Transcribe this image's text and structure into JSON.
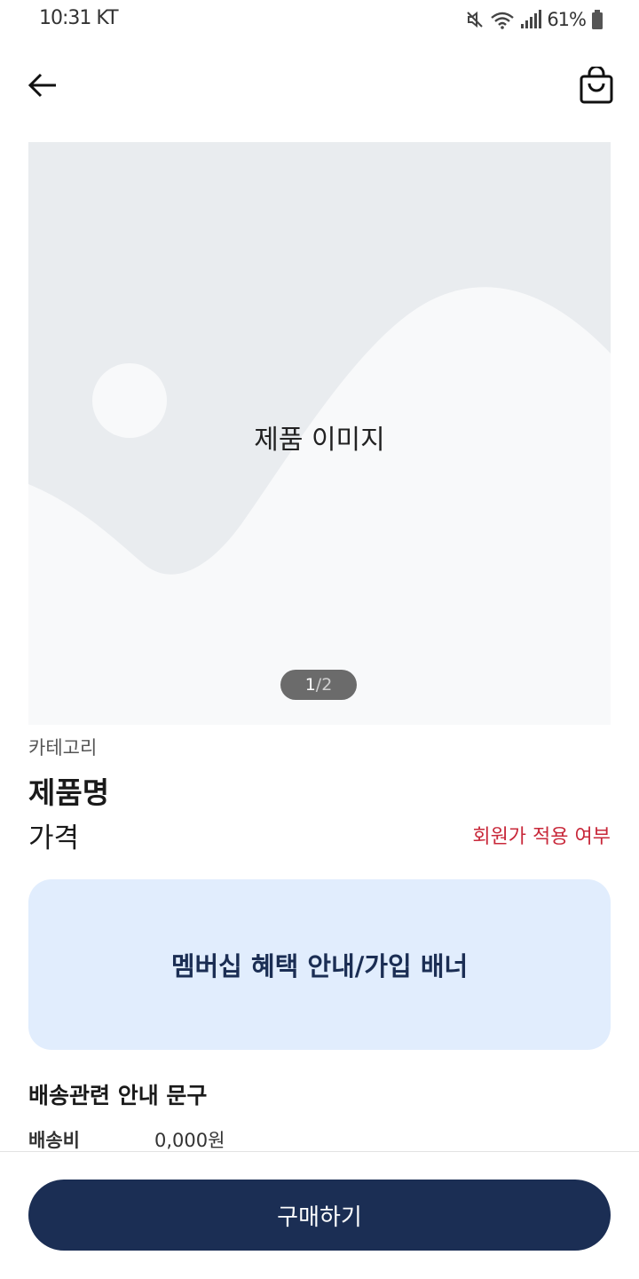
{
  "status_bar": {
    "time": "10:31 KT",
    "battery": "61%",
    "icons": [
      "mute-icon",
      "wifi-icon",
      "signal-icon",
      "battery-icon"
    ]
  },
  "app_bar": {
    "back_icon": "arrow-left-icon",
    "cart_icon": "shopping-bag-icon"
  },
  "product_image": {
    "label": "제품 이미지",
    "page_current": "1",
    "page_separator": " / ",
    "page_total": "2"
  },
  "product": {
    "category": "카테고리",
    "name": "제품명",
    "price": "가격",
    "member_price_note": "회원가 적용 여부"
  },
  "banner": {
    "text": "멤버십 혜택 안내/가입 배너"
  },
  "shipping": {
    "title": "배송관련 안내 문구",
    "fee_label": "배송비",
    "fee_value": "0,000원"
  },
  "bottom": {
    "buy_label": "구매하기"
  },
  "colors": {
    "accent": "#1b2e54",
    "banner_bg": "#e1edfd",
    "member_price": "#c8283a",
    "image_bg": "#e9ecef"
  }
}
